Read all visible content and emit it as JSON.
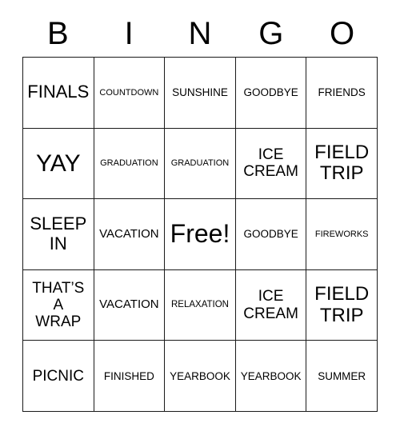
{
  "header": {
    "letters": [
      "B",
      "I",
      "N",
      "G",
      "O"
    ]
  },
  "grid": {
    "rows": 5,
    "columns": 5,
    "cells": [
      {
        "text": "FINALS",
        "size": "s-2xl"
      },
      {
        "text": "COUNTDOWN",
        "size": "s-xs"
      },
      {
        "text": "SUNSHINE",
        "size": "s-md"
      },
      {
        "text": "GOODBYE",
        "size": "s-md"
      },
      {
        "text": "FRIENDS",
        "size": "s-md"
      },
      {
        "text": "YAY",
        "size": "s-4xl"
      },
      {
        "text": "GRADUATION",
        "size": "s-xs"
      },
      {
        "text": "GRADUATION",
        "size": "s-xs"
      },
      {
        "text": "ICE\nCREAM",
        "size": "s-xl"
      },
      {
        "text": "FIELD\nTRIP",
        "size": "s-3xl"
      },
      {
        "text": "SLEEP\nIN",
        "size": "s-2xl"
      },
      {
        "text": "VACATION",
        "size": "s-lg"
      },
      {
        "text": "Free!",
        "size": "s-free"
      },
      {
        "text": "GOODBYE",
        "size": "s-md"
      },
      {
        "text": "FIREWORKS",
        "size": "s-xs"
      },
      {
        "text": "THAT’S\nA\nWRAP",
        "size": "s-xl"
      },
      {
        "text": "VACATION",
        "size": "s-lg"
      },
      {
        "text": "RELAXATION",
        "size": "s-sm"
      },
      {
        "text": "ICE\nCREAM",
        "size": "s-xl"
      },
      {
        "text": "FIELD\nTRIP",
        "size": "s-3xl"
      },
      {
        "text": "PICNIC",
        "size": "s-xl"
      },
      {
        "text": "FINISHED",
        "size": "s-md"
      },
      {
        "text": "YEARBOOK",
        "size": "s-md"
      },
      {
        "text": "YEARBOOK",
        "size": "s-md"
      },
      {
        "text": "SUMMER",
        "size": "s-md"
      }
    ]
  },
  "colors": {
    "background": "#ffffff",
    "text": "#000000",
    "gridline": "#1a1a1a"
  }
}
